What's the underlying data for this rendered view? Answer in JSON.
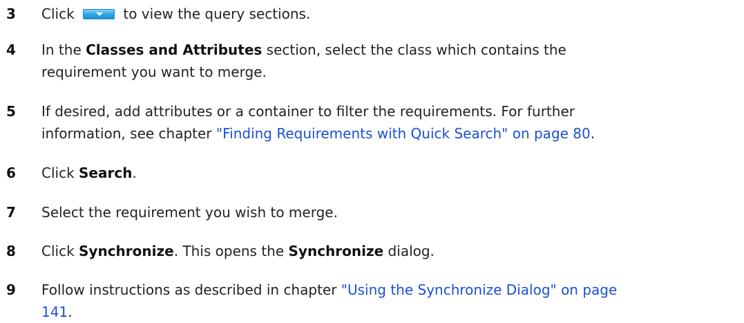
{
  "steps": [
    {
      "num": "3",
      "parts": {
        "a": "Click ",
        "b": " to view the query sections."
      },
      "icon": "dropdown-arrow-button"
    },
    {
      "num": "4",
      "line1": {
        "a": "In the ",
        "bold": "Classes and Attributes",
        "b": " section, select the class which contains the"
      },
      "line2": "requirement you want to merge."
    },
    {
      "num": "5",
      "line1": "If desired, add attributes or a container to filter the requirements. For further",
      "line2": {
        "a": "information, see chapter ",
        "link": "\"Finding Requirements with Quick Search\" on page 80",
        "b": "."
      }
    },
    {
      "num": "6",
      "a": "Click ",
      "bold": "Search",
      "b": "."
    },
    {
      "num": "7",
      "text": "Select the requirement you wish to merge."
    },
    {
      "num": "8",
      "a": "Click ",
      "bold1": "Synchronize",
      "b": ". This opens the ",
      "bold2": "Synchronize",
      "c": " dialog."
    },
    {
      "num": "9",
      "line1": {
        "a": "Follow instructions as described in chapter ",
        "link": "\"Using the Synchronize Dialog\" on page"
      },
      "line2": {
        "link": "141",
        "b": "."
      }
    }
  ],
  "colors": {
    "link": "#1a4fd8",
    "text": "#222222",
    "button": "#2aa5e3"
  }
}
